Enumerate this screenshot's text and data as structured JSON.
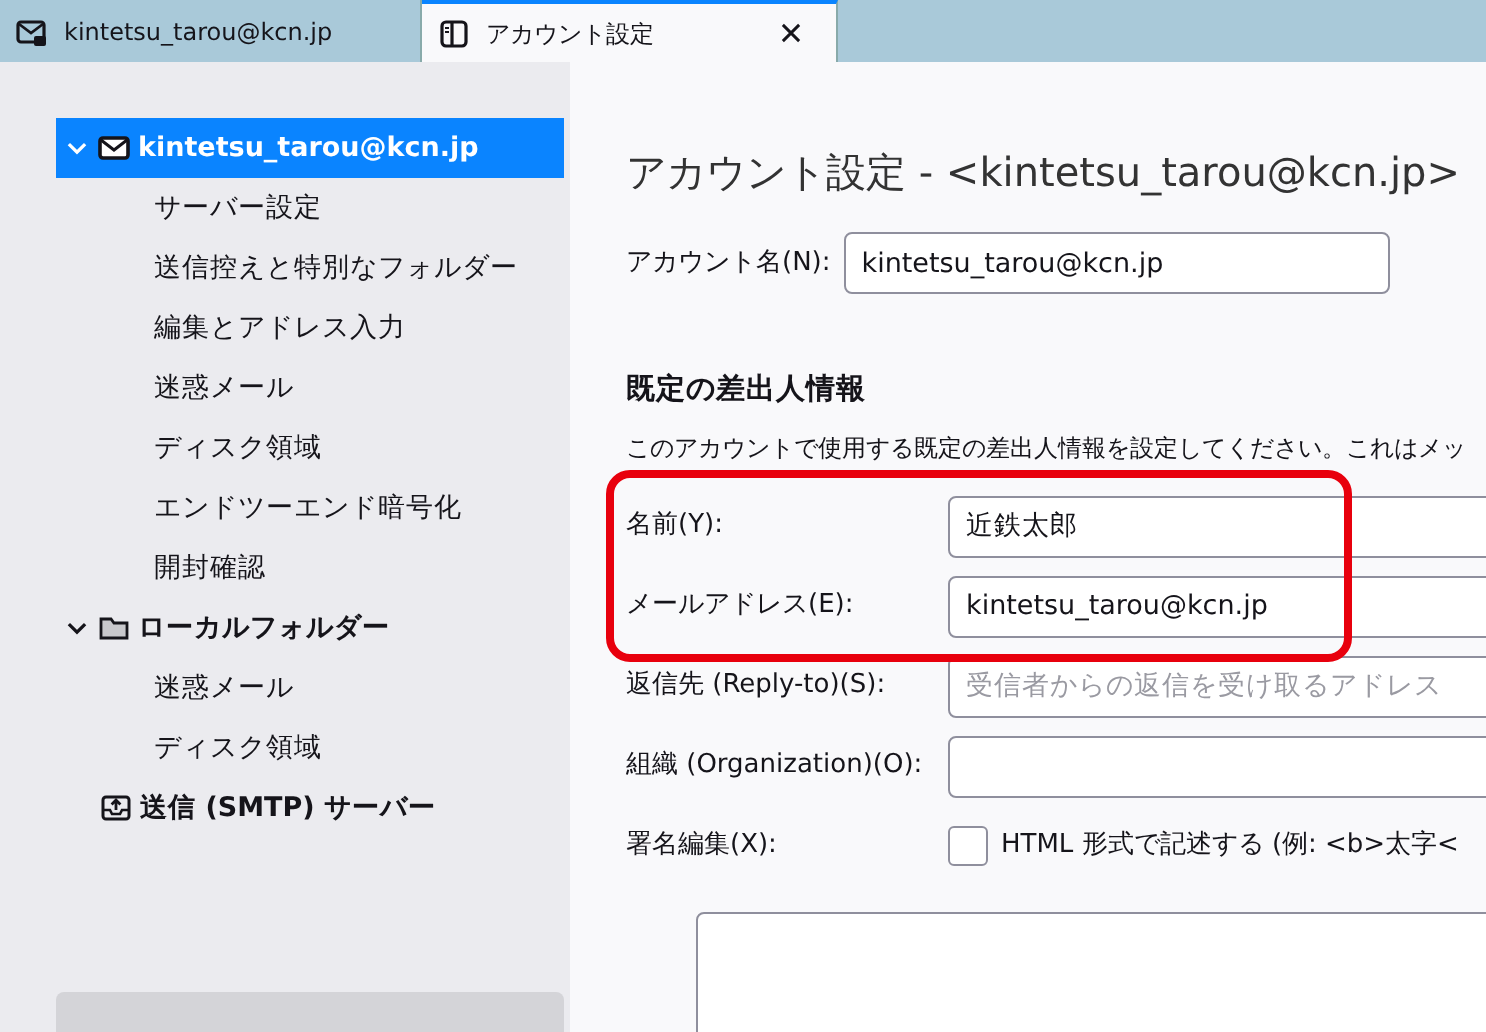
{
  "tabs": [
    {
      "label": "kintetsu_tarou@kcn.jp",
      "kind": "mail",
      "selected": false,
      "closable": false
    },
    {
      "label": "アカウント設定",
      "kind": "settings",
      "selected": true,
      "closable": true
    }
  ],
  "sidebar": {
    "items": [
      {
        "label": "kintetsu_tarou@kcn.jp",
        "kind": "account",
        "expanded": true,
        "selected": true,
        "children": [
          {
            "label": "サーバー設定",
            "selected": false
          },
          {
            "label": "送信控えと特別なフォルダー",
            "selected": false
          },
          {
            "label": "編集とアドレス入力",
            "selected": false
          },
          {
            "label": "迷惑メール",
            "selected": false
          },
          {
            "label": "ディスク領域",
            "selected": false
          },
          {
            "label": "エンドツーエンド暗号化",
            "selected": false
          },
          {
            "label": "開封確認",
            "selected": false
          }
        ]
      },
      {
        "label": "ローカルフォルダー",
        "kind": "folder",
        "expanded": true,
        "selected": false,
        "children": [
          {
            "label": "迷惑メール",
            "selected": false
          },
          {
            "label": "ディスク領域",
            "selected": false
          }
        ]
      },
      {
        "label": "送信 (SMTP) サーバー",
        "kind": "smtp",
        "selected": false
      }
    ]
  },
  "content": {
    "title": "アカウント設定 - <kintetsu_tarou@kcn.jp>",
    "account_name": {
      "label": "アカウント名(N):",
      "value": "kintetsu_tarou@kcn.jp"
    },
    "section_heading": "既定の差出人情報",
    "description": "このアカウントで使用する既定の差出人情報を設定してください。これはメッ",
    "fields": [
      {
        "label": "名前(Y):",
        "value": "近鉄太郎",
        "highlighted": true
      },
      {
        "label": "メールアドレス(E):",
        "value": "kintetsu_tarou@kcn.jp",
        "highlighted": true
      },
      {
        "label": "返信先 (Reply-to)(S):",
        "placeholder": "受信者からの返信を受け取るアドレス",
        "highlighted": false
      },
      {
        "label": "組織 (Organization)(O):",
        "highlighted": false
      }
    ],
    "signature": {
      "label": "署名編集(X):",
      "checked": false,
      "checkbox_label": "HTML 形式で記述する (例: <b>太字<"
    }
  }
}
